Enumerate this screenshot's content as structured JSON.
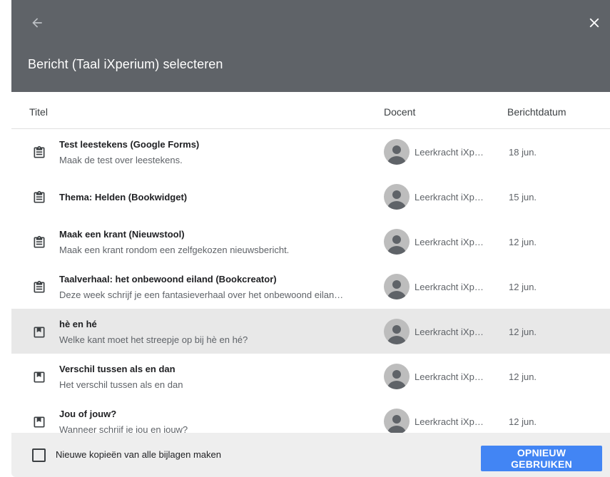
{
  "dialog": {
    "title": "Bericht (Taal iXperium) selecteren",
    "back_icon": "arrow-back-icon",
    "close_icon": "close-icon"
  },
  "columns": {
    "title": "Titel",
    "teacher": "Docent",
    "date": "Berichtdatum"
  },
  "rows": [
    {
      "icon": "assignment-icon",
      "title": "Test leestekens (Google Forms)",
      "subtitle": "Maak de test over leestekens.",
      "teacher": "Leerkracht iXp…",
      "date": "18 jun."
    },
    {
      "icon": "assignment-icon",
      "title": "Thema: Helden (Bookwidget)",
      "subtitle": "",
      "teacher": "Leerkracht iXp…",
      "date": "15 jun."
    },
    {
      "icon": "assignment-icon",
      "title": "Maak een krant (Nieuwstool)",
      "subtitle": "Maak een krant rondom een zelfgekozen nieuwsbericht.",
      "teacher": "Leerkracht iXp…",
      "date": "12 jun."
    },
    {
      "icon": "assignment-icon",
      "title": "Taalverhaal: het onbewoond eiland (Bookcreator)",
      "subtitle": "Deze week schrijf je een fantasieverhaal over het onbewoond eilan…",
      "teacher": "Leerkracht iXp…",
      "date": "12 jun."
    },
    {
      "icon": "material-icon",
      "title": "hè en hé",
      "subtitle": "Welke kant moet het streepje op bij hè en hé?",
      "teacher": "Leerkracht iXp…",
      "date": "12 jun.",
      "selected": true
    },
    {
      "icon": "material-icon",
      "title": "Verschil tussen als en dan",
      "subtitle": "Het verschil tussen als en dan",
      "teacher": "Leerkracht iXp…",
      "date": "12 jun."
    },
    {
      "icon": "material-icon",
      "title": "Jou of jouw?",
      "subtitle": "Wanneer schrijf je jou en jouw?",
      "teacher": "Leerkracht iXp…",
      "date": "12 jun."
    }
  ],
  "footer": {
    "checkbox_label": "Nieuwe kopieën van alle bijlagen maken",
    "checkbox_checked": false,
    "reuse_button": "OPNIEUW GEBRUIKEN"
  },
  "colors": {
    "header_bg": "#5f6368",
    "accent": "#4285f4",
    "selected_row": "#e8e8e8",
    "footer_bg": "#eeeeee"
  }
}
